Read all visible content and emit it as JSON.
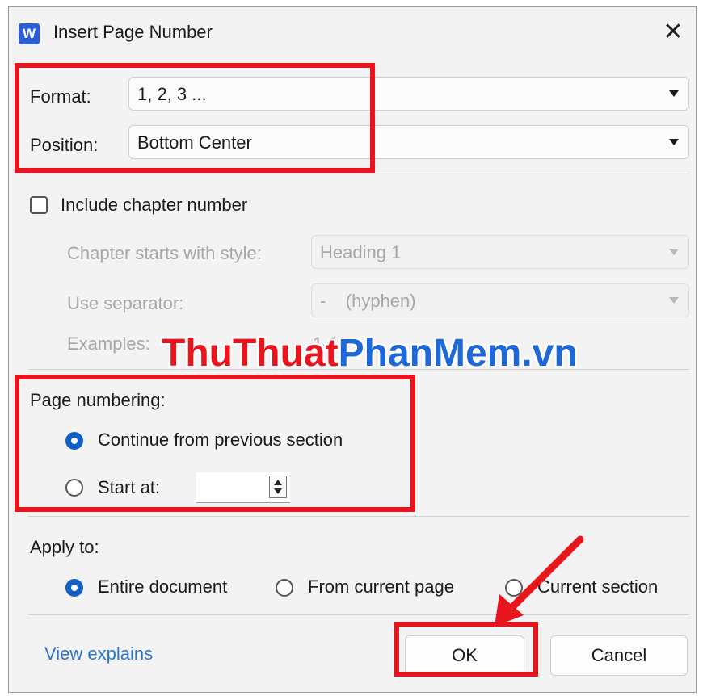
{
  "window": {
    "title": "Insert Page Number",
    "icon_letter": "W",
    "close_glyph": "✕"
  },
  "format": {
    "label": "Format:",
    "value": "1, 2, 3 ..."
  },
  "position": {
    "label": "Position:",
    "value": "Bottom Center"
  },
  "chapter": {
    "include_label": "Include chapter number",
    "include_checked": false,
    "starts_with_label": "Chapter starts with style:",
    "starts_with_value": "Heading 1",
    "separator_label": "Use separator:",
    "separator_value": "-    (hyphen)",
    "examples_label": "Examples:",
    "examples_value": "1-1"
  },
  "page_numbering": {
    "label": "Page numbering:",
    "continue_label": "Continue from previous section",
    "start_at_label": "Start at:",
    "start_at_value": "",
    "selected": "continue"
  },
  "apply_to": {
    "label": "Apply to:",
    "options": [
      "Entire document",
      "From current page",
      "Current section"
    ],
    "selected": "Entire document"
  },
  "footer": {
    "link": "View explains",
    "ok": "OK",
    "cancel": "Cancel"
  },
  "watermark": {
    "part1": "ThuThuat",
    "part2": "PhanMem.vn"
  },
  "colors": {
    "accent": "#0f5fc7",
    "highlight": "#e8141e",
    "link": "#2d73c9"
  }
}
